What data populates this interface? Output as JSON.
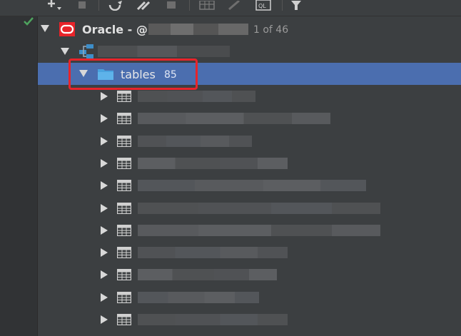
{
  "connection": {
    "name": "Oracle - @",
    "count": "1 of 46"
  },
  "folder": {
    "label": "tables",
    "count": "85"
  },
  "table_rows": 11
}
